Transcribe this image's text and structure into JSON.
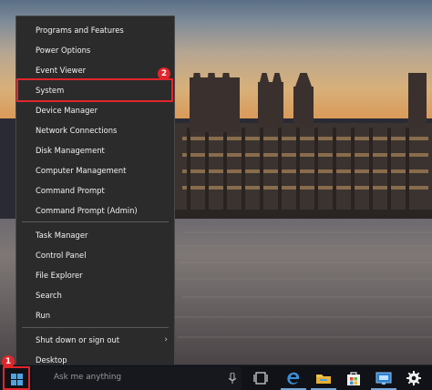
{
  "menu": {
    "items": [
      {
        "label": "Programs and Features"
      },
      {
        "label": "Power Options"
      },
      {
        "label": "Event Viewer"
      },
      {
        "label": "System"
      },
      {
        "label": "Device Manager"
      },
      {
        "label": "Network Connections"
      },
      {
        "label": "Disk Management"
      },
      {
        "label": "Computer Management"
      },
      {
        "label": "Command Prompt"
      },
      {
        "label": "Command Prompt (Admin)"
      },
      {
        "label": "Task Manager"
      },
      {
        "label": "Control Panel"
      },
      {
        "label": "File Explorer"
      },
      {
        "label": "Search"
      },
      {
        "label": "Run"
      },
      {
        "label": "Shut down or sign out"
      },
      {
        "label": "Desktop"
      }
    ],
    "highlighted": "System"
  },
  "annotations": {
    "step1": "1",
    "step2": "2",
    "highlight_color": "#e0262b"
  },
  "taskbar": {
    "search_placeholder": "Ask me anything",
    "icons": [
      "windows-logo-icon",
      "microphone-icon",
      "task-view-icon",
      "edge-icon",
      "file-explorer-icon",
      "store-icon",
      "monitor-app-icon",
      "settings-gear-icon"
    ]
  }
}
